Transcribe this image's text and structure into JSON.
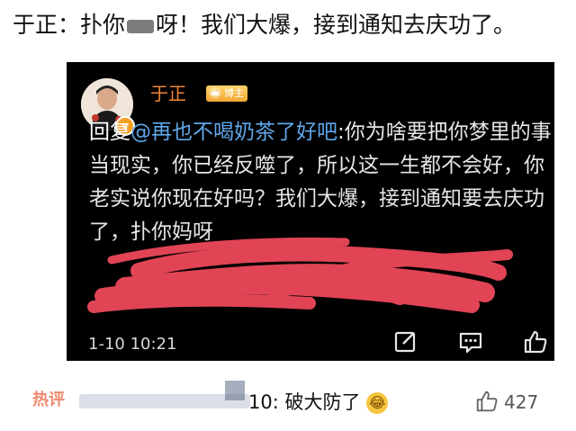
{
  "headline": {
    "part1": "于正：扑你",
    "part2": "呀！我们大爆，接到通知去庆功了。"
  },
  "comment": {
    "username": "于正",
    "role_badge": "博主",
    "verified_mark": "v",
    "reply_prefix": "回复",
    "mention": "@再也不喝奶茶了好吧",
    "text": ":你为啥要把你梦里的事当现实，你已经反噬了，所以这一生都不会好，你老实说你现在好吗？我们大爆，接到通知要去庆功了，扑你妈呀",
    "time": "1-10 10:21",
    "icons": [
      "edit-icon",
      "comment-icon",
      "like-icon"
    ]
  },
  "reply": {
    "hot_label": "热评",
    "user_suffix": "10:",
    "text": "破大防了",
    "emoji": "😂",
    "likes": "427"
  }
}
